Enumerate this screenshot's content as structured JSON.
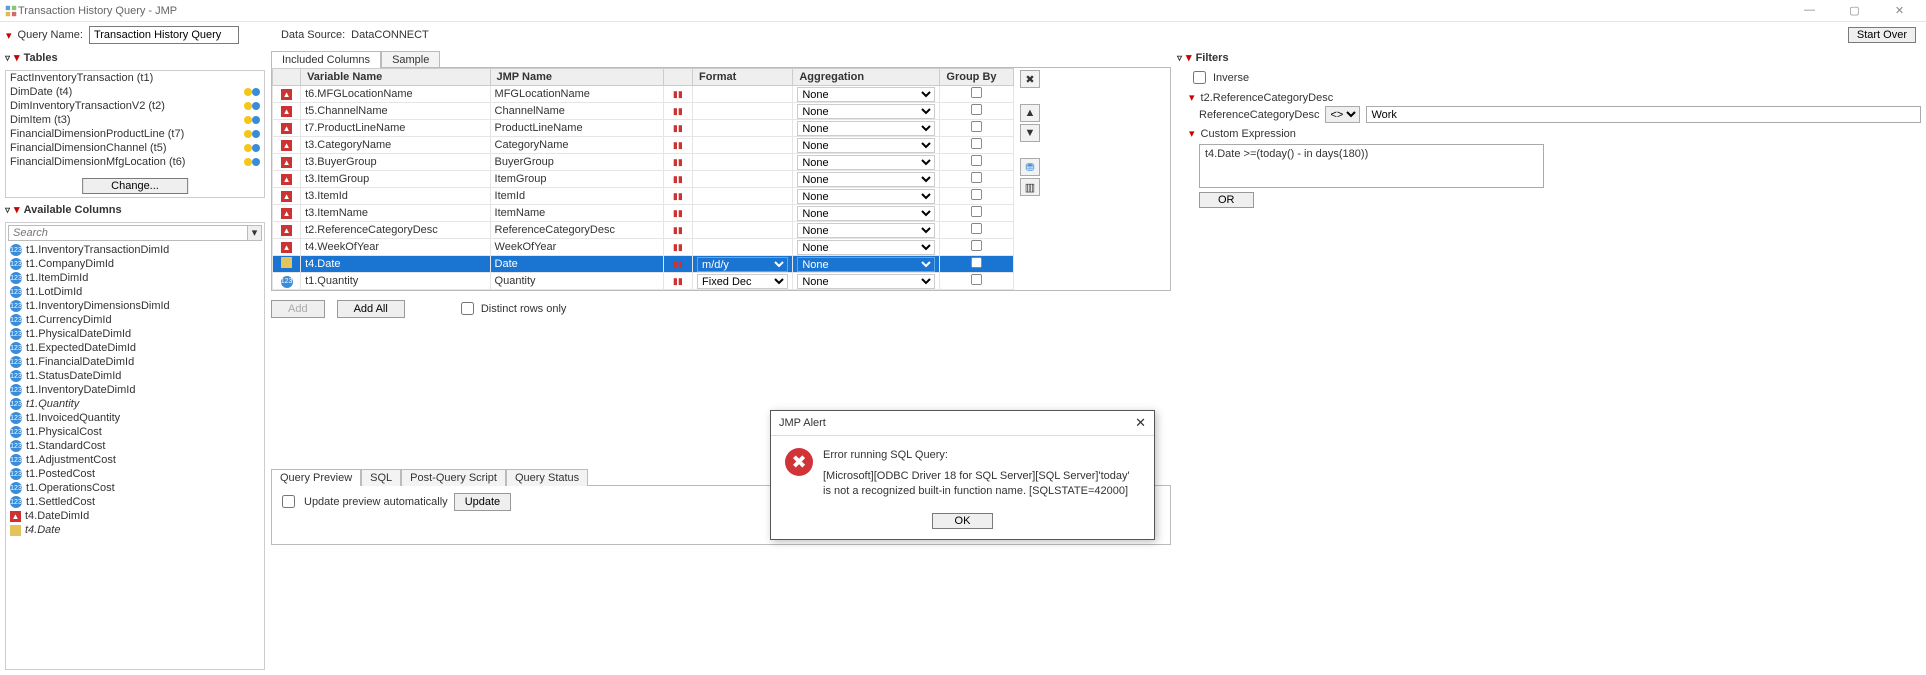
{
  "window": {
    "title": "Transaction History Query - JMP"
  },
  "win_controls": {
    "min": "—",
    "max": "▢",
    "close": "✕"
  },
  "header": {
    "query_label": "Query Name:",
    "query_value": "Transaction History Query",
    "ds_label": "Data Source:",
    "ds_value": "DataCONNECT",
    "start_over": "Start Over"
  },
  "tables": {
    "title": "Tables",
    "items": [
      {
        "name": "FactInventoryTransaction (t1)",
        "dots": false
      },
      {
        "name": "DimDate (t4)",
        "dots": true
      },
      {
        "name": "DimInventoryTransactionV2 (t2)",
        "dots": true
      },
      {
        "name": "DimItem (t3)",
        "dots": true
      },
      {
        "name": "FinancialDimensionProductLine (t7)",
        "dots": true
      },
      {
        "name": "FinancialDimensionChannel (t5)",
        "dots": true
      },
      {
        "name": "FinancialDimensionMfgLocation (t6)",
        "dots": true
      }
    ],
    "change": "Change..."
  },
  "available": {
    "title": "Available Columns",
    "search_placeholder": "Search",
    "items": [
      {
        "icon": "num",
        "name": "t1.InventoryTransactionDimId"
      },
      {
        "icon": "num",
        "name": "t1.CompanyDimId"
      },
      {
        "icon": "num",
        "name": "t1.ItemDimId"
      },
      {
        "icon": "num",
        "name": "t1.LotDimId"
      },
      {
        "icon": "num",
        "name": "t1.InventoryDimensionsDimId"
      },
      {
        "icon": "num",
        "name": "t1.CurrencyDimId"
      },
      {
        "icon": "num",
        "name": "t1.PhysicalDateDimId"
      },
      {
        "icon": "num",
        "name": "t1.ExpectedDateDimId"
      },
      {
        "icon": "num",
        "name": "t1.FinancialDateDimId"
      },
      {
        "icon": "num",
        "name": "t1.StatusDateDimId"
      },
      {
        "icon": "num",
        "name": "t1.InventoryDateDimId"
      },
      {
        "icon": "num",
        "name": "t1.Quantity",
        "ital": true
      },
      {
        "icon": "num",
        "name": "t1.InvoicedQuantity"
      },
      {
        "icon": "num",
        "name": "t1.PhysicalCost"
      },
      {
        "icon": "num",
        "name": "t1.StandardCost"
      },
      {
        "icon": "num",
        "name": "t1.AdjustmentCost"
      },
      {
        "icon": "num",
        "name": "t1.PostedCost"
      },
      {
        "icon": "num",
        "name": "t1.OperationsCost"
      },
      {
        "icon": "num",
        "name": "t1.SettledCost"
      },
      {
        "icon": "cat",
        "name": "t4.DateDimId"
      },
      {
        "icon": "date",
        "name": "t4.Date",
        "ital": true
      }
    ]
  },
  "included": {
    "tab1": "Included Columns",
    "tab2": "Sample",
    "headers": {
      "var": "Variable Name",
      "jmp": "JMP Name",
      "fmt": "Format",
      "agg": "Aggregation",
      "grp": "Group By"
    },
    "rows": [
      {
        "icon": "cat",
        "var": "t6.MFGLocationName",
        "jmp": "MFGLocationName",
        "fmt": "",
        "agg": "None",
        "grp": false
      },
      {
        "icon": "cat",
        "var": "t5.ChannelName",
        "jmp": "ChannelName",
        "fmt": "",
        "agg": "None",
        "grp": false
      },
      {
        "icon": "cat",
        "var": "t7.ProductLineName",
        "jmp": "ProductLineName",
        "fmt": "",
        "agg": "None",
        "grp": false
      },
      {
        "icon": "cat",
        "var": "t3.CategoryName",
        "jmp": "CategoryName",
        "fmt": "",
        "agg": "None",
        "grp": false
      },
      {
        "icon": "cat",
        "var": "t3.BuyerGroup",
        "jmp": "BuyerGroup",
        "fmt": "",
        "agg": "None",
        "grp": false
      },
      {
        "icon": "cat",
        "var": "t3.ItemGroup",
        "jmp": "ItemGroup",
        "fmt": "",
        "agg": "None",
        "grp": false
      },
      {
        "icon": "cat",
        "var": "t3.ItemId",
        "jmp": "ItemId",
        "fmt": "",
        "agg": "None",
        "grp": false
      },
      {
        "icon": "cat",
        "var": "t3.ItemName",
        "jmp": "ItemName",
        "fmt": "",
        "agg": "None",
        "grp": false
      },
      {
        "icon": "cat",
        "var": "t2.ReferenceCategoryDesc",
        "jmp": "ReferenceCategoryDesc",
        "fmt": "",
        "agg": "None",
        "grp": false
      },
      {
        "icon": "cat",
        "var": "t4.WeekOfYear",
        "jmp": "WeekOfYear",
        "fmt": "",
        "agg": "None",
        "grp": false
      },
      {
        "icon": "date",
        "var": "t4.Date",
        "jmp": "Date",
        "fmt": "m/d/y",
        "agg": "None",
        "grp": false,
        "sel": true
      },
      {
        "icon": "num",
        "var": "t1.Quantity",
        "jmp": "Quantity",
        "fmt": "Fixed Dec",
        "agg": "None",
        "grp": false
      }
    ],
    "buttons": {
      "add": "Add",
      "add_all": "Add All",
      "distinct": "Distinct rows only"
    }
  },
  "preview": {
    "tabs": [
      "Query Preview",
      "SQL",
      "Post-Query Script",
      "Query Status"
    ],
    "auto": "Update preview automatically",
    "update": "Update"
  },
  "filters": {
    "title": "Filters",
    "inverse": "Inverse",
    "sec1": {
      "title": "t2.ReferenceCategoryDesc",
      "label": "ReferenceCategoryDesc",
      "op": "<>",
      "value": "Work"
    },
    "sec2": {
      "title": "Custom Expression",
      "expr": "t4.Date >=(today() - in days(180))"
    },
    "or": "OR"
  },
  "dialog": {
    "title": "JMP Alert",
    "line1": "Error running SQL Query:",
    "line2": "[Microsoft][ODBC Driver 18 for SQL Server][SQL Server]'today' is not a recognized built-in function name. [SQLSTATE=42000]",
    "ok": "OK"
  },
  "side_icons": {
    "remove": "✖",
    "up": "▲",
    "down": "▼",
    "filter": "⛃",
    "cols": "▥"
  }
}
